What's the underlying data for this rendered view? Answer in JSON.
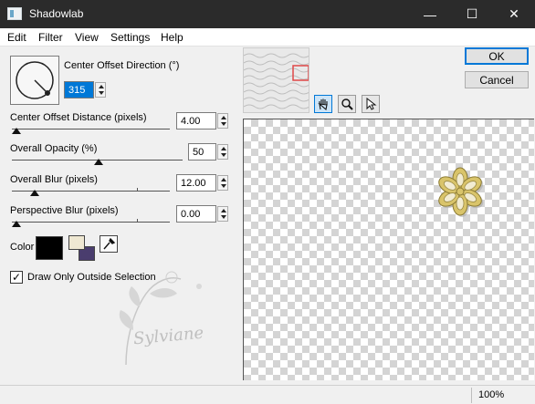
{
  "window": {
    "title": "Shadowlab",
    "minimize_glyph": "—",
    "maximize_glyph": "☐",
    "close_glyph": "✕"
  },
  "menu": [
    "Edit",
    "Filter",
    "View",
    "Settings",
    "Help"
  ],
  "controls": {
    "direction": {
      "label": "Center Offset Direction (°)",
      "value": "315"
    },
    "distance": {
      "label": "Center Offset Distance (pixels)",
      "value": "4.00",
      "level": 0.02
    },
    "opacity": {
      "label": "Overall Opacity (%)",
      "value": "50",
      "level": 0.5
    },
    "blur": {
      "label": "Overall Blur (pixels)",
      "value": "12.00",
      "level": 0.12
    },
    "perspective_blur": {
      "label": "Perspective Blur (pixels)",
      "value": "0.00",
      "level": 0.0
    },
    "color": {
      "label": "Color",
      "primary": "#000000",
      "secondary": "#efe8d2",
      "tertiary": "#4a3d6e"
    },
    "outside_selection": {
      "label": "Draw Only Outside Selection",
      "checked": true,
      "check_glyph": "✓"
    }
  },
  "buttons": {
    "ok": "OK",
    "cancel": "Cancel"
  },
  "preview": {
    "tools": [
      "hand-icon",
      "zoom-icon",
      "arrow-icon"
    ]
  },
  "watermark": {
    "text": "Sylviane"
  },
  "status": {
    "zoom": "100%"
  },
  "colors": {
    "titlebar": "#2b2b2b",
    "accent": "#0078d7",
    "navigator_frame": "#e04848",
    "flower_gold": "#d9c46a"
  }
}
